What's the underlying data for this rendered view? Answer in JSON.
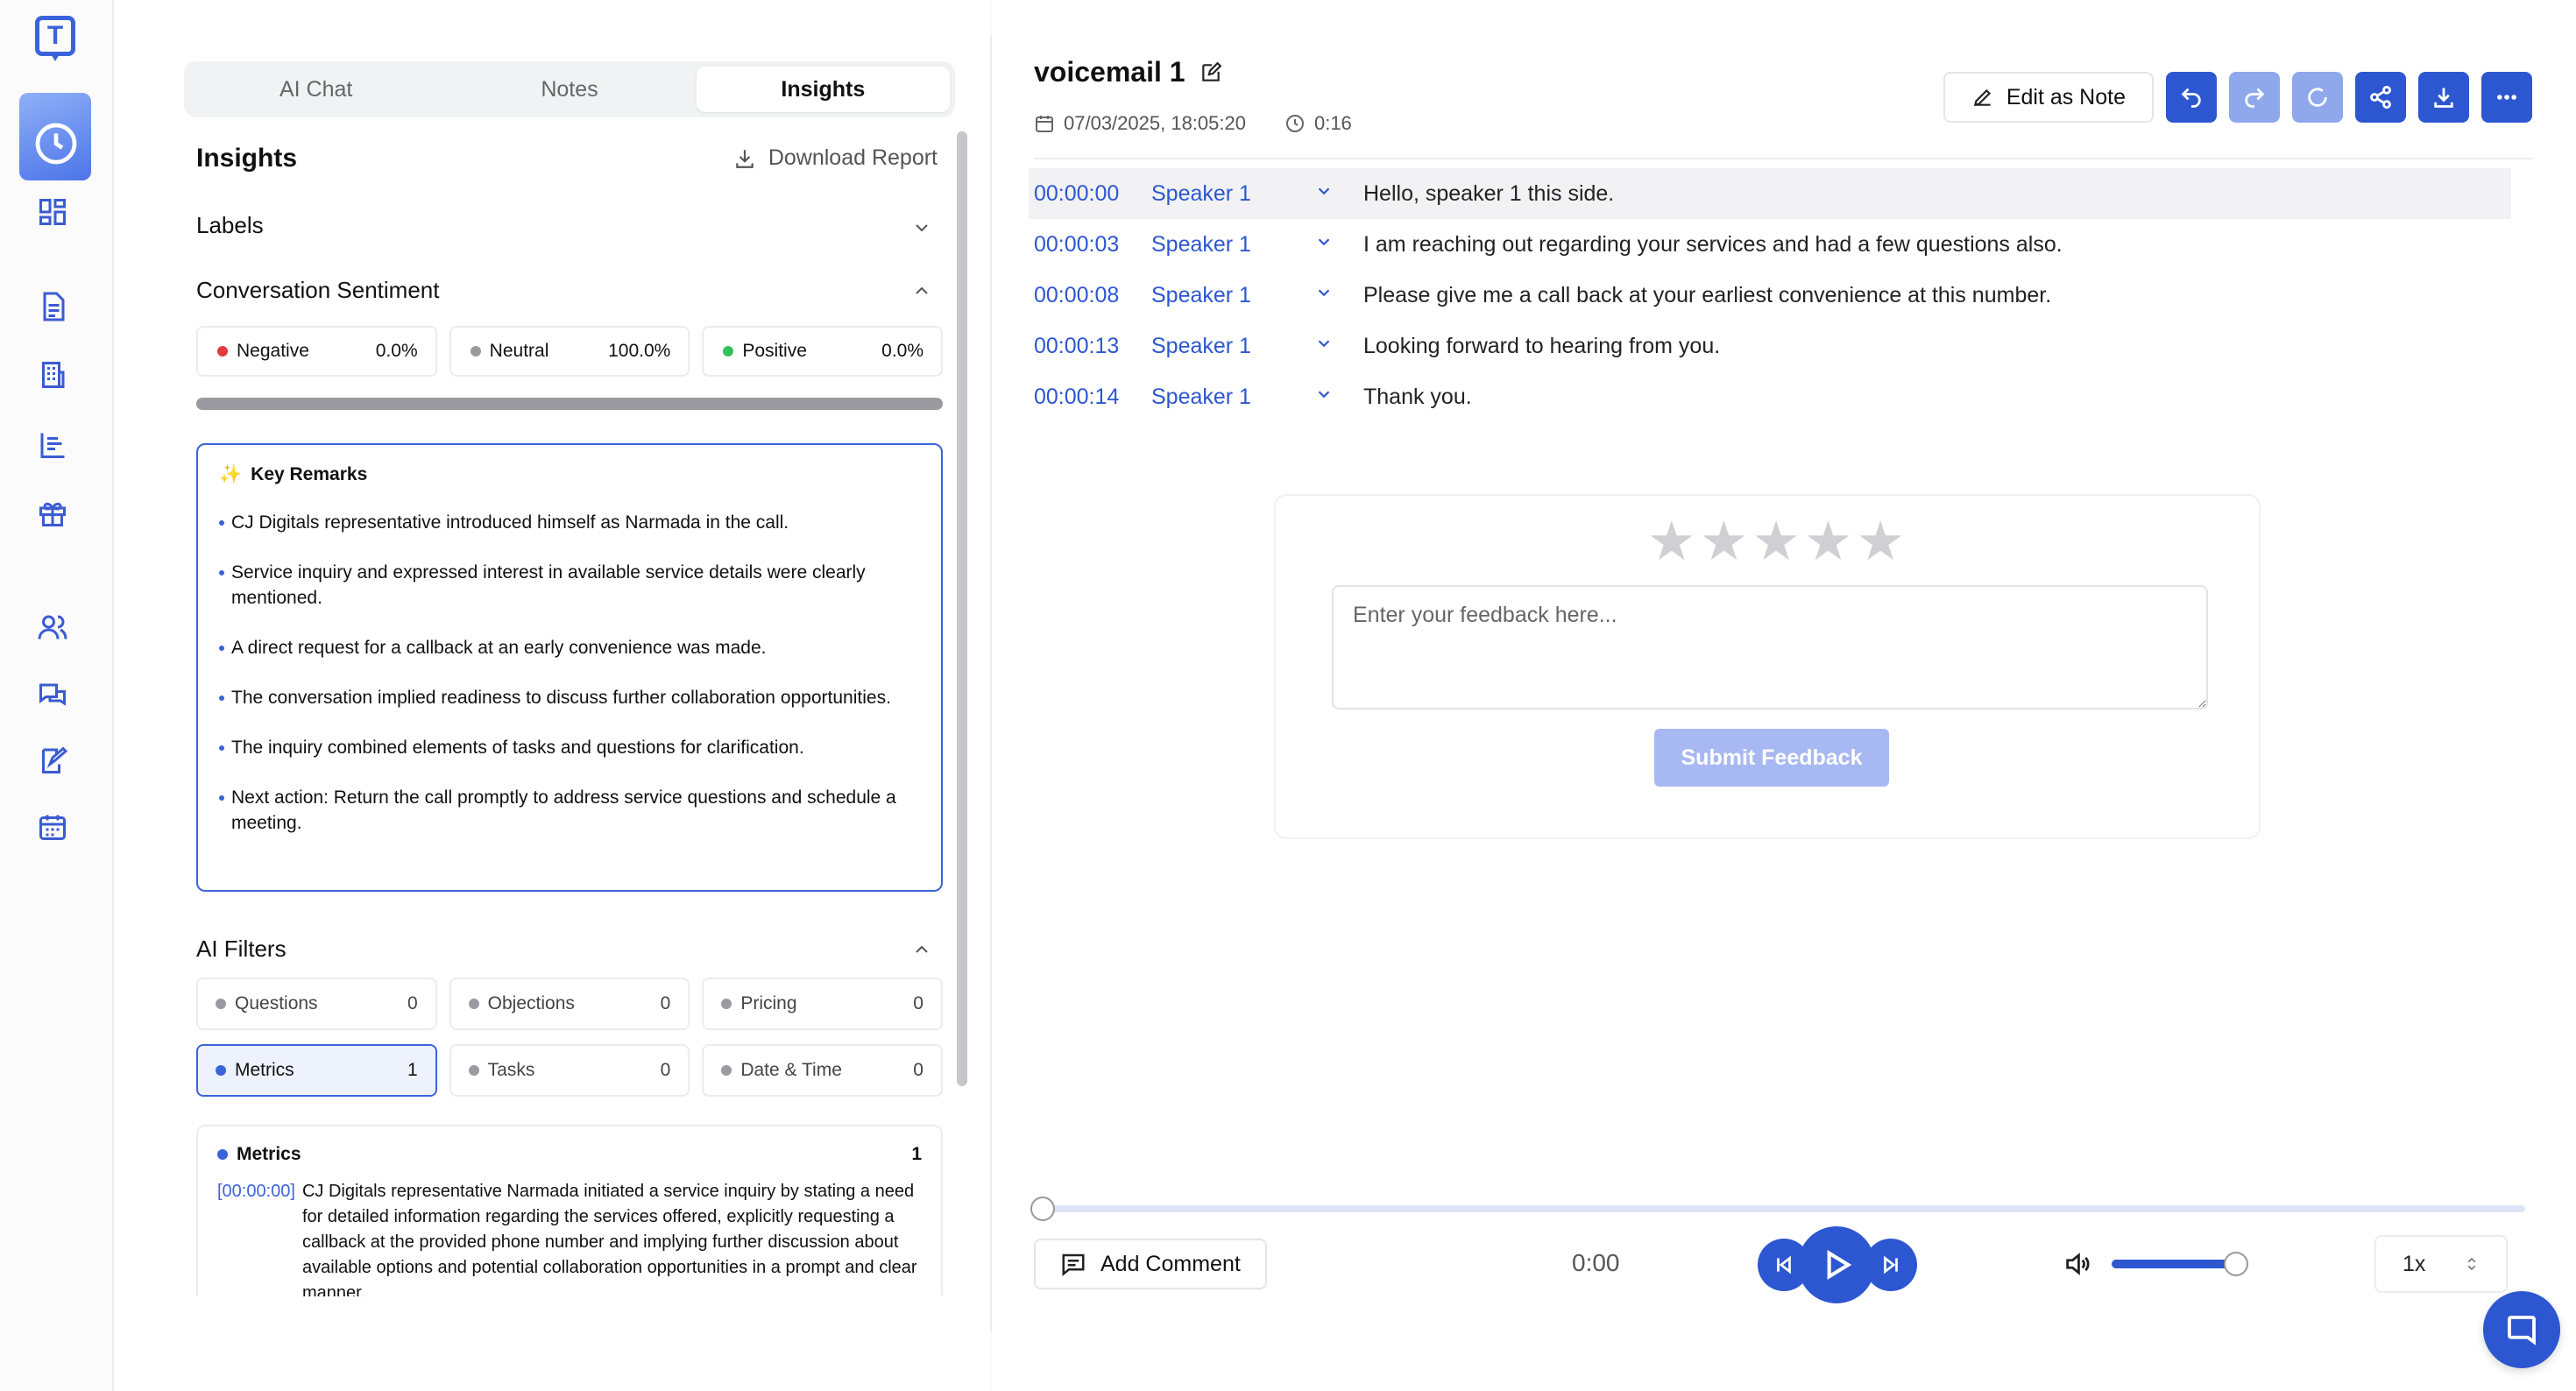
{
  "logo": {
    "letter": "T"
  },
  "tabs": [
    {
      "label": "AI Chat"
    },
    {
      "label": "Notes"
    },
    {
      "label": "Insights"
    }
  ],
  "insights": {
    "title": "Insights",
    "download_label": "Download Report",
    "labels_title": "Labels",
    "sentiment_title": "Conversation Sentiment",
    "sentiment": [
      {
        "label": "Negative",
        "value": "0.0%",
        "color": "#e23b3b"
      },
      {
        "label": "Neutral",
        "value": "100.0%",
        "color": "#9a9aa0"
      },
      {
        "label": "Positive",
        "value": "0.0%",
        "color": "#34c15a"
      }
    ],
    "key_remarks_title": "Key Remarks",
    "key_remarks": [
      "CJ Digitals representative introduced himself as Narmada in the call.",
      "Service inquiry and expressed interest in available service details were clearly mentioned.",
      "A direct request for a callback at an early convenience was made.",
      "The conversation implied readiness to discuss further collaboration opportunities.",
      "The inquiry combined elements of tasks and questions for clarification.",
      "Next action: Return the call promptly to address service questions and schedule a meeting."
    ],
    "ai_filters_title": "AI Filters",
    "filters": [
      {
        "label": "Questions",
        "count": "0"
      },
      {
        "label": "Objections",
        "count": "0"
      },
      {
        "label": "Pricing",
        "count": "0"
      },
      {
        "label": "Metrics",
        "count": "1"
      },
      {
        "label": "Tasks",
        "count": "0"
      },
      {
        "label": "Date & Time",
        "count": "0"
      }
    ],
    "metrics_box": {
      "title": "Metrics",
      "count": "1",
      "timestamp": "[00:00:00]",
      "text": "CJ Digitals representative Narmada initiated a service inquiry by stating a need for detailed information regarding the services offered, explicitly requesting a callback at the provided phone number and implying further discussion about available options and potential collaboration opportunities in a prompt and clear manner."
    }
  },
  "recording": {
    "title": "voicemail 1",
    "date": "07/03/2025, 18:05:20",
    "duration": "0:16",
    "edit_note_label": "Edit as Note"
  },
  "transcript": [
    {
      "ts": "00:00:00",
      "speaker": "Speaker 1",
      "text": "Hello, speaker 1 this side."
    },
    {
      "ts": "00:00:03",
      "speaker": "Speaker 1",
      "text": "I am reaching out regarding your services and had a few questions also."
    },
    {
      "ts": "00:00:08",
      "speaker": "Speaker 1",
      "text": "Please give me a call back at your earliest convenience at this number."
    },
    {
      "ts": "00:00:13",
      "speaker": "Speaker 1",
      "text": "Looking forward to hearing from you."
    },
    {
      "ts": "00:00:14",
      "speaker": "Speaker 1",
      "text": "Thank you."
    }
  ],
  "feedback": {
    "placeholder": "Enter your feedback here...",
    "submit_label": "Submit Feedback",
    "rating": 0,
    "max_rating": 5
  },
  "player": {
    "add_comment_label": "Add Comment",
    "current_time": "0:00",
    "speed": "1x",
    "progress": 0,
    "volume": 1.0
  },
  "colors": {
    "accent": "#2d56d1",
    "accent_dim": "#8fa8ec"
  }
}
